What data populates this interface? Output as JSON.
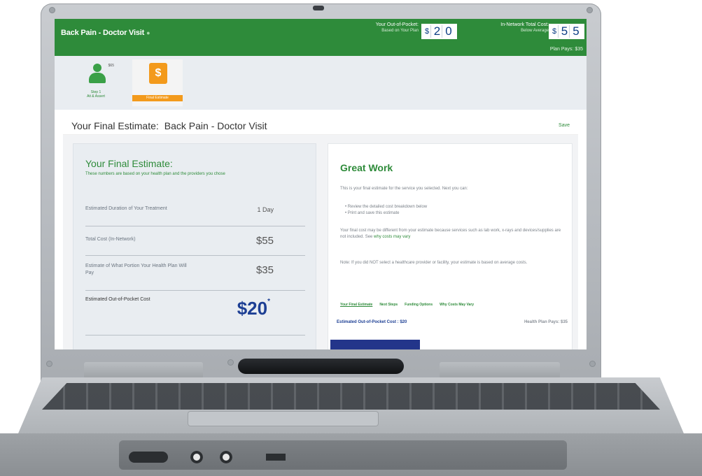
{
  "header": {
    "app_title": "Back Pain - Doctor Visit",
    "oop_label": "Your Out-of-Pocket:",
    "oop_sub": "Based on Your Plan",
    "oop_currency": "$",
    "oop_digits": [
      "2",
      "0"
    ],
    "net_label": "In-Network Total Cost:",
    "net_sub": "Below Average",
    "net_currency": "$",
    "net_digits": [
      "5",
      "5"
    ],
    "plan_pays": "Plan Pays: $35"
  },
  "steps": [
    {
      "label_line1": "Step 1",
      "label_line2": "Ait & Assert",
      "badge": "$65"
    },
    {
      "label": "Final Estimate"
    }
  ],
  "page": {
    "title": "Your Final Estimate:",
    "title_subject": "Back Pain - Doctor Visit",
    "save": "Save"
  },
  "left_card": {
    "heading": "Your Final Estimate:",
    "intro": "These numbers are based on your health plan and the providers you chose",
    "rows": [
      {
        "label": "Estimated Duration of Your Treatment",
        "value": "1 Day"
      },
      {
        "label": "Total Cost (In-Network)",
        "value": "$55"
      },
      {
        "label": "Estimate of What Portion Your Health Plan Will Pay",
        "value": "$35"
      },
      {
        "label": "Estimated Out-of-Pocket Cost",
        "value": "$20",
        "mark": "*"
      }
    ]
  },
  "right_card": {
    "heading": "Great Work",
    "p1": "This is your final estimate for the service you selected. Next you can:",
    "bullets": [
      "Review the detailed cost breakdown below",
      "Print and save this estimate"
    ],
    "p2": "Your final cost may be different from your estimate because services such as lab work, x-rays and devices/supplies are not included. See",
    "p2_link": "why costs may vary",
    "p3": "Note: If you did NOT select a healthcare provider or facility, your estimate is based on average costs.",
    "tabs": [
      "Your Final Estimate",
      "Next Steps",
      "Funding Options",
      "Why Costs May Vary"
    ],
    "summary_left": "Estimated Out-of-Pocket Cost : $20",
    "summary_right": "Health Plan Pays: $35"
  }
}
